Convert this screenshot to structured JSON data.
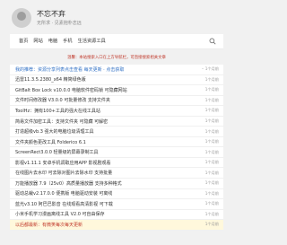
{
  "site": {
    "title": "不忘不弃",
    "subtitle": "无所求 · 见素抱朴志远"
  },
  "nav": {
    "items": [
      "首页",
      "网站",
      "电脑",
      "手机",
      "生活资源工具"
    ]
  },
  "notice": "温馨：本站搜索入口在上方导航栏，可直接搜索相关文章",
  "posts": [
    {
      "title": "我的推荐：资源分享列表点击查看 每天更新 · 点击获取",
      "date": "·· 1个月前"
    },
    {
      "title": "迅雷11.3.5.2380_x64 精简绿色版",
      "date": "1个月前"
    },
    {
      "title": "GitBalt Box Lock v10.0.0 电脑软件密码锁 可隐藏网站",
      "date": "1个月前"
    },
    {
      "title": "文件时间修改器 V3.0.0 可批量修改 支持文件夹",
      "date": "1个月前"
    },
    {
      "title": "ToolHz：拥有100+工具的强大在线工具站",
      "date": "1个月前"
    },
    {
      "title": "简易文件加密工具：支持文件夹 可隐藏 可解密",
      "date": "1个月前"
    },
    {
      "title": "打造超级vb.3 强大的电脑垃圾清理工具",
      "date": "1个月前"
    },
    {
      "title": "文件夹颜色更改工具 Folderico 6.1",
      "date": "1个月前"
    },
    {
      "title": "ScreenRect3.0.0 轻量级的屏幕录制工具",
      "date": "1个月前"
    },
    {
      "title": "影视v1.11.1 安卓手机调取应用APP 影视剧观看",
      "date": "1个月前"
    },
    {
      "title": "在线图片去水印 可去除对图片去除水印 支持批量",
      "date": "1个月前"
    },
    {
      "title": "万能播放器 7.9（25v0）高质量播放器 支持多种格式",
      "date": "1个月前"
    },
    {
      "title": "驱动总裁v2.17.0.0 便携版 电脑驱动安装 可离线",
      "date": "1个月前"
    },
    {
      "title": "蓝光v3.10 阿巴巴影音 在线观看高清影视 可下载",
      "date": "1个月前"
    },
    {
      "title": "小米手机学习漫画离线工具 V2.0 可自由保存",
      "date": "1个月前"
    },
    {
      "title": "以后都最新：有微笑每次每天更新",
      "date": "1个月前"
    }
  ]
}
